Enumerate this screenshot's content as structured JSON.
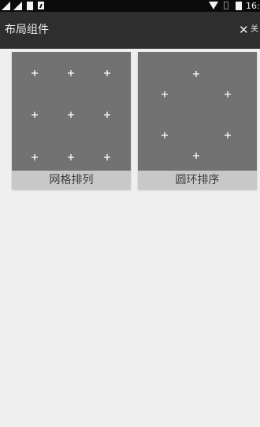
{
  "toolbar": {
    "title": "布局组件",
    "close_icon": "close-icon",
    "close_label": "关"
  },
  "status_bar": {
    "time": "16:"
  },
  "cards": [
    {
      "label": "网格排列",
      "icon": "grid-layout-icon"
    },
    {
      "label": "圆环排序",
      "icon": "circle-layout-icon"
    }
  ],
  "colors": {
    "toolbar_bg": "#2e2e2e",
    "status_bar_bg": "#0b0b0b",
    "card_preview_bg": "#727272",
    "card_label_bg": "#c8c8c8",
    "page_bg": "#efefef"
  }
}
